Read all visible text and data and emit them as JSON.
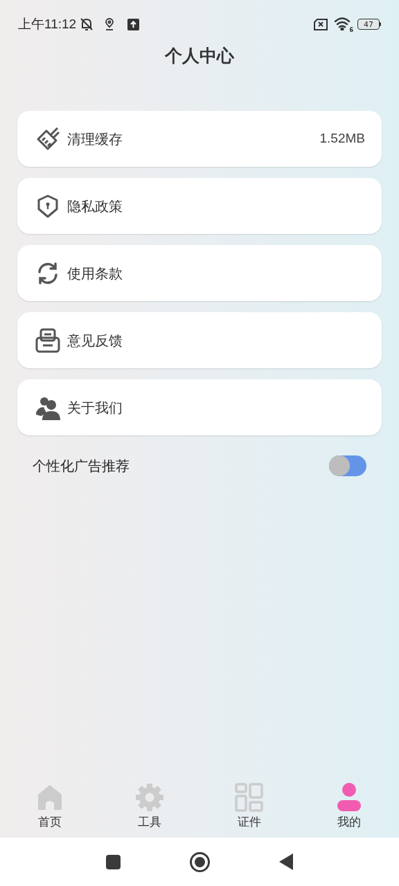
{
  "status_bar": {
    "time": "上午11:12",
    "battery": "47",
    "wifi_badge": "6"
  },
  "header": {
    "title": "个人中心"
  },
  "menu": [
    {
      "label": "清理缓存",
      "value": "1.52MB"
    },
    {
      "label": "隐私政策"
    },
    {
      "label": "使用条款"
    },
    {
      "label": "意见反馈"
    },
    {
      "label": "关于我们"
    }
  ],
  "ad_setting": {
    "label": "个性化广告推荐",
    "on": false
  },
  "tabs": [
    {
      "label": "首页",
      "selected": false
    },
    {
      "label": "工具",
      "selected": false
    },
    {
      "label": "证件",
      "selected": false
    },
    {
      "label": "我的",
      "selected": true
    }
  ]
}
